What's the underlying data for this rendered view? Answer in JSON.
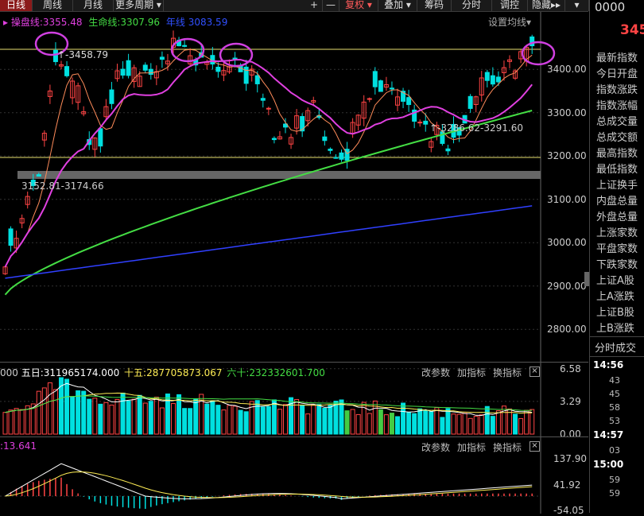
{
  "toolbar": {
    "tabs": [
      "日线",
      "周线",
      "月线",
      "更多周期"
    ],
    "plus": "+",
    "minus": "—",
    "fuquan": "复权",
    "diejia": "叠加",
    "choumа": "筹码",
    "fenshi": "分时",
    "zhouzhi": "调控",
    "hide": "隐藏",
    "arrow": "▸▸"
  },
  "main": {
    "legend_a": "操盘线:",
    "legend_a_val": "3355.48",
    "legend_b": "生命线:",
    "legend_b_val": "3307.96",
    "legend_c": "年线",
    "legend_c_val": "3083.59",
    "settings": "设置均线",
    "ann_high": "3458.79",
    "ann_low": "3152.81-3174.66",
    "ann_gap": "3286.62-3291.60",
    "y_ticks": [
      "3400.00",
      "3300.00",
      "3200.00",
      "3100.00",
      "3000.00",
      "2900.00",
      "2800.00"
    ]
  },
  "volume": {
    "prefix": "000",
    "label1": "五日:",
    "val1": "311965174.000",
    "label2": "十五:",
    "val2": "287705873.067",
    "label3": "六十:",
    "val3": "232332601.700",
    "btn_param": "改参数",
    "btn_add": "加指标",
    "btn_switch": "换指标",
    "close": "×",
    "y_ticks": [
      "6.58",
      "3.29",
      "0.00"
    ]
  },
  "macd": {
    "prefix": ":13.641",
    "btn_param": "改参数",
    "btn_add": "加指标",
    "btn_switch": "换指标",
    "close": "×",
    "y_ticks": [
      "137.90",
      "41.92",
      "-54.05"
    ]
  },
  "right_panel": {
    "code": "0000",
    "price": "345",
    "items": [
      "最新指数",
      "今日开盘",
      "指数涨跌",
      "指数涨幅",
      "总成交量",
      "总成交额",
      "最高指数",
      "最低指数",
      "上证换手",
      "内盘总量",
      "外盘总量",
      "上涨家数",
      "平盘家数",
      "下跌家数",
      "上证A股",
      "上A涨跌",
      "上证B股",
      "上B涨跌"
    ],
    "ticks_title": "分时成交",
    "ticks": [
      {
        "time": "14:56",
        "minutes": [
          "43",
          "45",
          "58",
          "53"
        ]
      },
      {
        "time": "14:57",
        "minutes": [
          "03"
        ]
      },
      {
        "time": "15:00",
        "minutes": [
          "59",
          "59"
        ]
      }
    ]
  },
  "colors": {
    "up": "#ff4444",
    "down": "#00e0e0",
    "ma_short": "#ff8c5a",
    "ma_mid": "#e040e0",
    "ma_life": "#44dd44",
    "ma_year": "#3040ff",
    "circle": "#d040e0"
  }
}
